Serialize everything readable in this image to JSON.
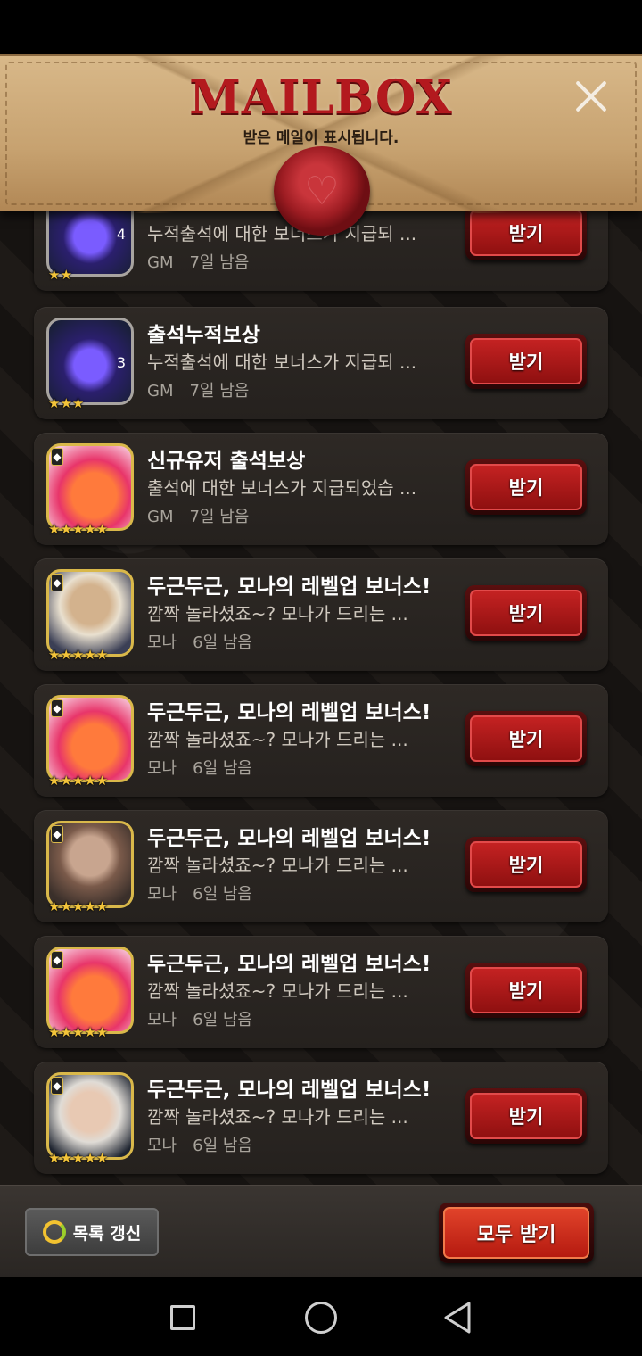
{
  "header": {
    "title": "MAILBOX",
    "subtitle": "받은 메일이 표시됩니다."
  },
  "mails": [
    {
      "title": "",
      "body": "누적출석에 대한 보너스가 지급되  ...",
      "sender": "GM",
      "expires": "7일 남음",
      "button": "받기",
      "count": "4",
      "stars": "★★",
      "icon": "gem-icon"
    },
    {
      "title": "출석누적보상",
      "body": "누적출석에 대한 보너스가 지급되  ...",
      "sender": "GM",
      "expires": "7일 남음",
      "button": "받기",
      "count": "3",
      "stars": "★★★",
      "icon": "gem-icon"
    },
    {
      "title": "신규유저 출석보상",
      "body": "출석에 대한 보너스가 지급되었습  ...",
      "sender": "GM",
      "expires": "7일 남음",
      "button": "받기",
      "count": "",
      "stars": "★★★★★",
      "icon": "heart-card-icon"
    },
    {
      "title": "두근두근, 모나의 레벨업 보너스!",
      "body": "깜짝 놀라셨죠~? 모나가 드리는  ...",
      "sender": "모나",
      "expires": "6일 남음",
      "button": "받기",
      "count": "",
      "stars": "★★★★★",
      "icon": "character-portrait-icon"
    },
    {
      "title": "두근두근, 모나의 레벨업 보너스!",
      "body": "깜짝 놀라셨죠~? 모나가 드리는  ...",
      "sender": "모나",
      "expires": "6일 남음",
      "button": "받기",
      "count": "",
      "stars": "★★★★★",
      "icon": "heart-card-icon"
    },
    {
      "title": "두근두근, 모나의 레벨업 보너스!",
      "body": "깜짝 놀라셨죠~? 모나가 드리는  ...",
      "sender": "모나",
      "expires": "6일 남음",
      "button": "받기",
      "count": "",
      "stars": "★★★★★",
      "icon": "character-portrait-icon"
    },
    {
      "title": "두근두근, 모나의 레벨업 보너스!",
      "body": "깜짝 놀라셨죠~? 모나가 드리는  ...",
      "sender": "모나",
      "expires": "6일 남음",
      "button": "받기",
      "count": "",
      "stars": "★★★★★",
      "icon": "heart-card-icon"
    },
    {
      "title": "두근두근, 모나의 레벨업 보너스!",
      "body": "깜짝 놀라셨죠~? 모나가 드리는  ...",
      "sender": "모나",
      "expires": "6일 남음",
      "button": "받기",
      "count": "",
      "stars": "★★★★★",
      "icon": "character-portrait-icon"
    }
  ],
  "footer": {
    "refresh_label": "목록 갱신",
    "receive_all_label": "모두 받기"
  }
}
